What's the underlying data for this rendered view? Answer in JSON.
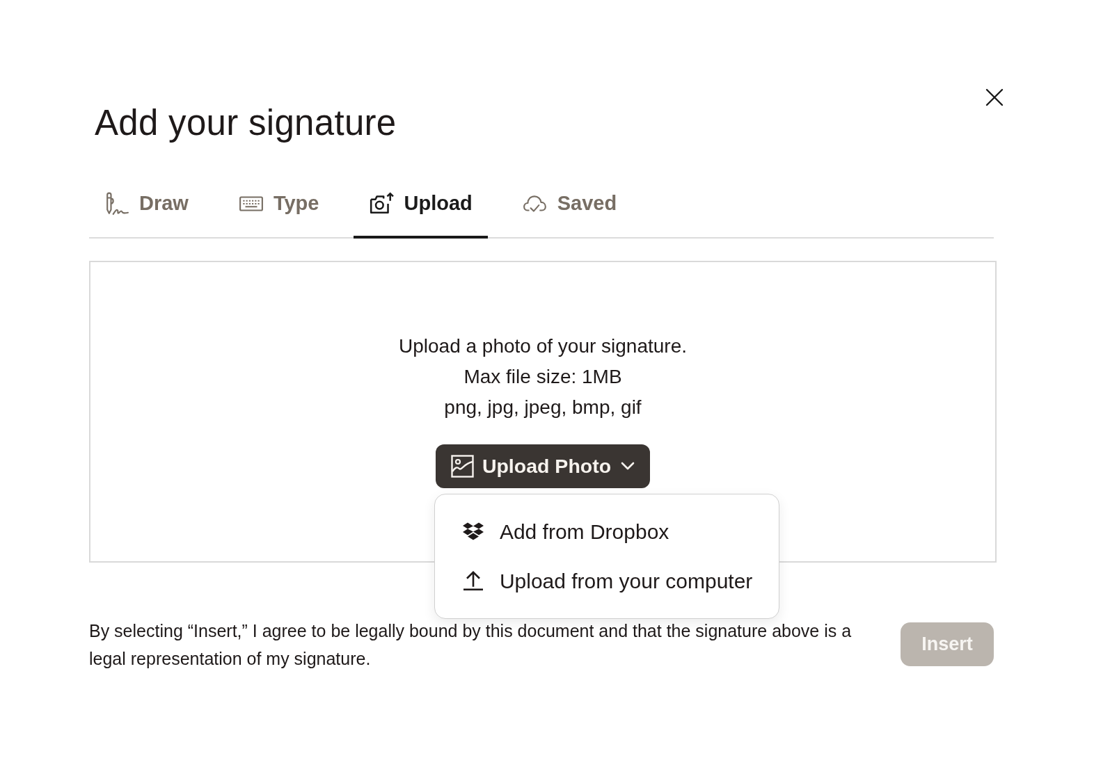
{
  "dialog": {
    "title": "Add your signature"
  },
  "tabs": [
    {
      "label": "Draw",
      "selected": false
    },
    {
      "label": "Type",
      "selected": false
    },
    {
      "label": "Upload",
      "selected": true
    },
    {
      "label": "Saved",
      "selected": false
    }
  ],
  "upload_panel": {
    "lines": [
      "Upload a photo of your signature.",
      "Max file size: 1MB",
      "png, jpg, jpeg, bmp, gif"
    ],
    "button": {
      "label": "Upload Photo",
      "expanded": true
    },
    "menu": [
      {
        "label": "Add from Dropbox"
      },
      {
        "label": "Upload from your computer"
      }
    ]
  },
  "footer": {
    "agreement": "By selecting “Insert,” I agree to be legally bound by this document and that the signature above is a legal representation of my signature.",
    "insert_button": {
      "label": "Insert",
      "disabled": true
    }
  }
}
